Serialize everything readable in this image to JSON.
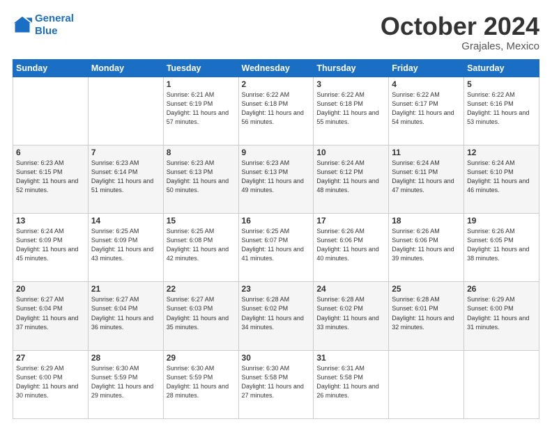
{
  "header": {
    "logo_line1": "General",
    "logo_line2": "Blue",
    "month": "October 2024",
    "location": "Grajales, Mexico"
  },
  "weekdays": [
    "Sunday",
    "Monday",
    "Tuesday",
    "Wednesday",
    "Thursday",
    "Friday",
    "Saturday"
  ],
  "weeks": [
    [
      {
        "day": "",
        "info": ""
      },
      {
        "day": "",
        "info": ""
      },
      {
        "day": "1",
        "info": "Sunrise: 6:21 AM\nSunset: 6:19 PM\nDaylight: 11 hours and 57 minutes."
      },
      {
        "day": "2",
        "info": "Sunrise: 6:22 AM\nSunset: 6:18 PM\nDaylight: 11 hours and 56 minutes."
      },
      {
        "day": "3",
        "info": "Sunrise: 6:22 AM\nSunset: 6:18 PM\nDaylight: 11 hours and 55 minutes."
      },
      {
        "day": "4",
        "info": "Sunrise: 6:22 AM\nSunset: 6:17 PM\nDaylight: 11 hours and 54 minutes."
      },
      {
        "day": "5",
        "info": "Sunrise: 6:22 AM\nSunset: 6:16 PM\nDaylight: 11 hours and 53 minutes."
      }
    ],
    [
      {
        "day": "6",
        "info": "Sunrise: 6:23 AM\nSunset: 6:15 PM\nDaylight: 11 hours and 52 minutes."
      },
      {
        "day": "7",
        "info": "Sunrise: 6:23 AM\nSunset: 6:14 PM\nDaylight: 11 hours and 51 minutes."
      },
      {
        "day": "8",
        "info": "Sunrise: 6:23 AM\nSunset: 6:13 PM\nDaylight: 11 hours and 50 minutes."
      },
      {
        "day": "9",
        "info": "Sunrise: 6:23 AM\nSunset: 6:13 PM\nDaylight: 11 hours and 49 minutes."
      },
      {
        "day": "10",
        "info": "Sunrise: 6:24 AM\nSunset: 6:12 PM\nDaylight: 11 hours and 48 minutes."
      },
      {
        "day": "11",
        "info": "Sunrise: 6:24 AM\nSunset: 6:11 PM\nDaylight: 11 hours and 47 minutes."
      },
      {
        "day": "12",
        "info": "Sunrise: 6:24 AM\nSunset: 6:10 PM\nDaylight: 11 hours and 46 minutes."
      }
    ],
    [
      {
        "day": "13",
        "info": "Sunrise: 6:24 AM\nSunset: 6:09 PM\nDaylight: 11 hours and 45 minutes."
      },
      {
        "day": "14",
        "info": "Sunrise: 6:25 AM\nSunset: 6:09 PM\nDaylight: 11 hours and 43 minutes."
      },
      {
        "day": "15",
        "info": "Sunrise: 6:25 AM\nSunset: 6:08 PM\nDaylight: 11 hours and 42 minutes."
      },
      {
        "day": "16",
        "info": "Sunrise: 6:25 AM\nSunset: 6:07 PM\nDaylight: 11 hours and 41 minutes."
      },
      {
        "day": "17",
        "info": "Sunrise: 6:26 AM\nSunset: 6:06 PM\nDaylight: 11 hours and 40 minutes."
      },
      {
        "day": "18",
        "info": "Sunrise: 6:26 AM\nSunset: 6:06 PM\nDaylight: 11 hours and 39 minutes."
      },
      {
        "day": "19",
        "info": "Sunrise: 6:26 AM\nSunset: 6:05 PM\nDaylight: 11 hours and 38 minutes."
      }
    ],
    [
      {
        "day": "20",
        "info": "Sunrise: 6:27 AM\nSunset: 6:04 PM\nDaylight: 11 hours and 37 minutes."
      },
      {
        "day": "21",
        "info": "Sunrise: 6:27 AM\nSunset: 6:04 PM\nDaylight: 11 hours and 36 minutes."
      },
      {
        "day": "22",
        "info": "Sunrise: 6:27 AM\nSunset: 6:03 PM\nDaylight: 11 hours and 35 minutes."
      },
      {
        "day": "23",
        "info": "Sunrise: 6:28 AM\nSunset: 6:02 PM\nDaylight: 11 hours and 34 minutes."
      },
      {
        "day": "24",
        "info": "Sunrise: 6:28 AM\nSunset: 6:02 PM\nDaylight: 11 hours and 33 minutes."
      },
      {
        "day": "25",
        "info": "Sunrise: 6:28 AM\nSunset: 6:01 PM\nDaylight: 11 hours and 32 minutes."
      },
      {
        "day": "26",
        "info": "Sunrise: 6:29 AM\nSunset: 6:00 PM\nDaylight: 11 hours and 31 minutes."
      }
    ],
    [
      {
        "day": "27",
        "info": "Sunrise: 6:29 AM\nSunset: 6:00 PM\nDaylight: 11 hours and 30 minutes."
      },
      {
        "day": "28",
        "info": "Sunrise: 6:30 AM\nSunset: 5:59 PM\nDaylight: 11 hours and 29 minutes."
      },
      {
        "day": "29",
        "info": "Sunrise: 6:30 AM\nSunset: 5:59 PM\nDaylight: 11 hours and 28 minutes."
      },
      {
        "day": "30",
        "info": "Sunrise: 6:30 AM\nSunset: 5:58 PM\nDaylight: 11 hours and 27 minutes."
      },
      {
        "day": "31",
        "info": "Sunrise: 6:31 AM\nSunset: 5:58 PM\nDaylight: 11 hours and 26 minutes."
      },
      {
        "day": "",
        "info": ""
      },
      {
        "day": "",
        "info": ""
      }
    ]
  ]
}
